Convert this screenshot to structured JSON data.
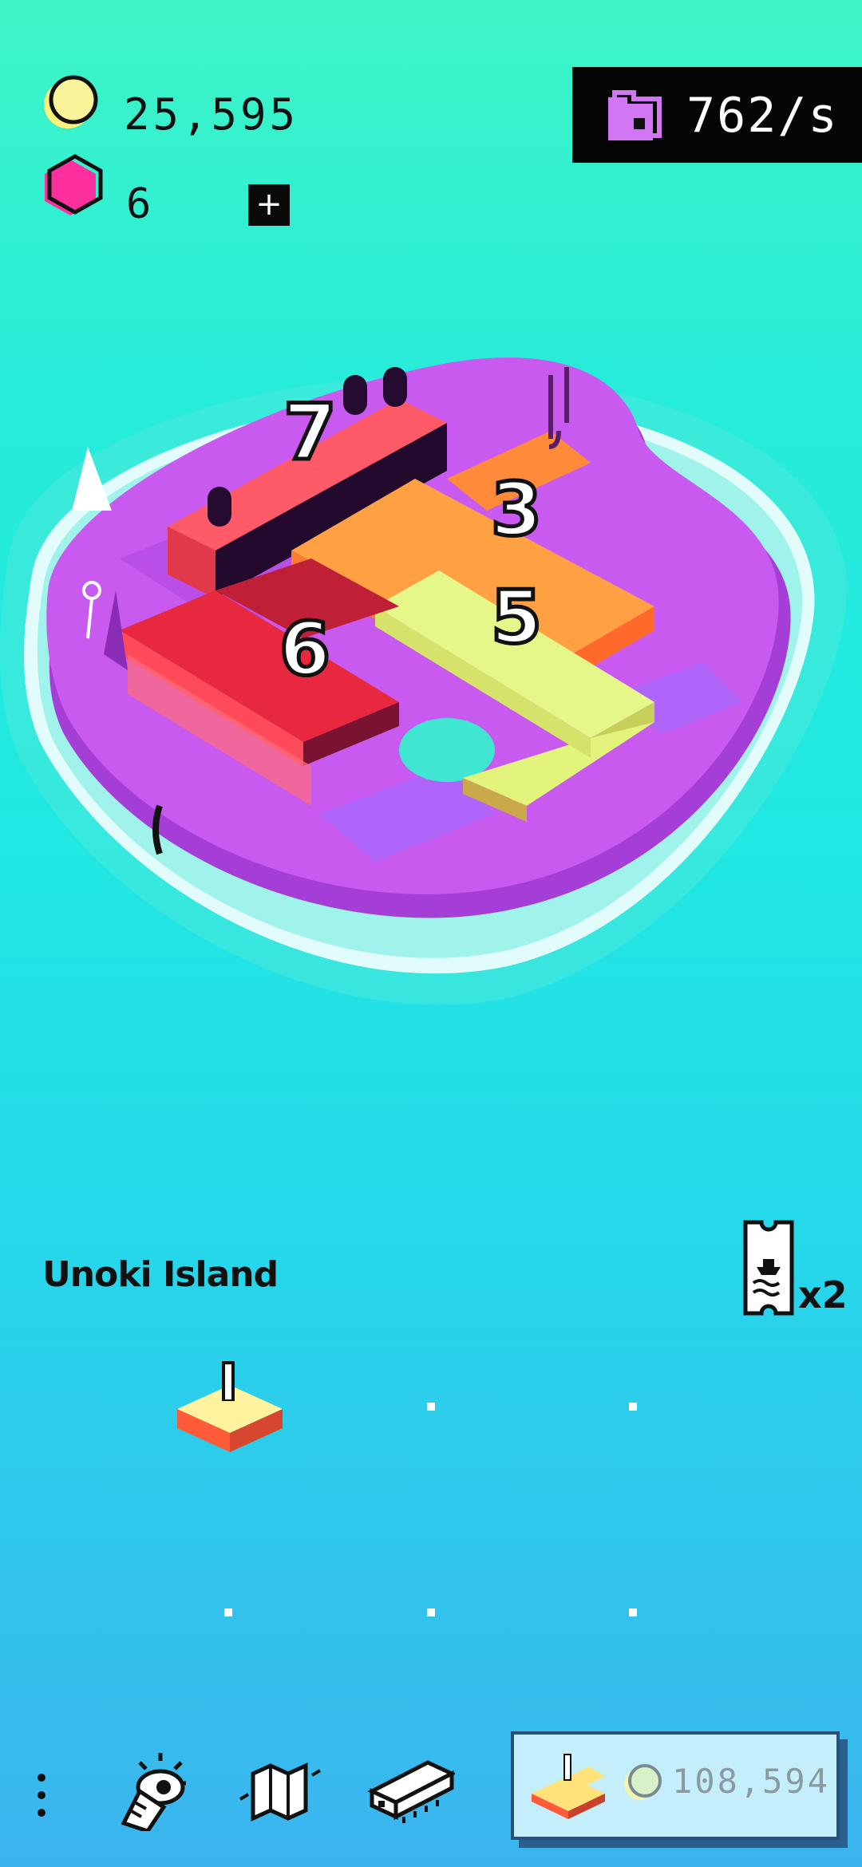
{
  "currency": {
    "coins": "25,595",
    "gems": "6",
    "add_label": "+"
  },
  "rate": {
    "value": "762/s"
  },
  "island": {
    "name": "Unoki Island",
    "building_numbers": [
      "7",
      "3",
      "6",
      "5"
    ]
  },
  "tickets": {
    "count": "x2"
  },
  "bottom_bar": {
    "buy_price": "108,594"
  },
  "icons": {
    "coin": "coin-icon",
    "gem": "gem-icon",
    "rate": "building-rate-icon",
    "ticket": "boat-ticket-icon",
    "menu": "more-vertical-icon",
    "explore": "lighthouse-icon",
    "map": "map-icon",
    "shop": "train-car-icon",
    "buy": "building-piece-icon"
  },
  "colors": {
    "island_purple": "#c95aef",
    "building_red": "#ff4a5a",
    "building_orange": "#ff8a3a",
    "building_yellow": "#dff47a",
    "building_crimson": "#e8283f"
  }
}
